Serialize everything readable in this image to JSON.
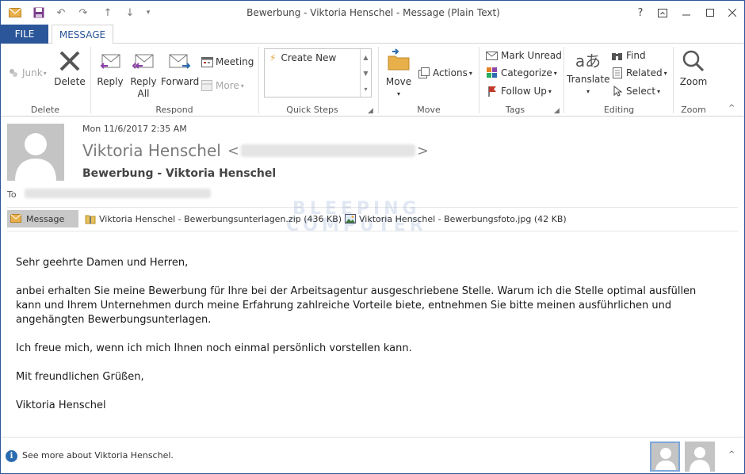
{
  "window": {
    "title": "Bewerbung - Viktoria Henschel - Message (Plain Text)",
    "help": "?",
    "controls": [
      "restore-ribbon",
      "minimize",
      "maximize",
      "close"
    ]
  },
  "tabs": {
    "file": "FILE",
    "message": "MESSAGE"
  },
  "ribbon": {
    "delete_group": {
      "junk": "Junk",
      "delete": "Delete",
      "label": "Delete"
    },
    "respond_group": {
      "reply": "Reply",
      "reply_all_1": "Reply",
      "reply_all_2": "All",
      "forward": "Forward",
      "meeting": "Meeting",
      "more": "More",
      "label": "Respond"
    },
    "quick_steps": {
      "create_new": "Create New",
      "label": "Quick Steps"
    },
    "move_group": {
      "move": "Move",
      "actions": "Actions",
      "label": "Move"
    },
    "tags_group": {
      "mark_unread": "Mark Unread",
      "categorize": "Categorize",
      "follow_up": "Follow Up",
      "label": "Tags"
    },
    "editing_group": {
      "translate": "Translate",
      "find": "Find",
      "related": "Related",
      "select": "Select",
      "label": "Editing"
    },
    "zoom_group": {
      "zoom": "Zoom",
      "label": "Zoom"
    }
  },
  "header": {
    "date": "Mon 11/6/2017 2:35 AM",
    "sender_name": "Viktoria Henschel",
    "subject": "Bewerbung - Viktoria Henschel",
    "to_label": "To"
  },
  "attachments": {
    "message_tab": "Message",
    "items": [
      {
        "name": "Viktoria Henschel - Bewerbungsunterlagen.zip (436 KB)",
        "icon": "zip-folder-icon"
      },
      {
        "name": "Viktoria Henschel - Bewerbungsfoto.jpg (42 KB)",
        "icon": "image-file-icon"
      }
    ]
  },
  "watermark": {
    "line1": "BLEEPING",
    "line2": "COMPUTER"
  },
  "body": {
    "paragraphs": [
      "Sehr geehrte Damen und Herren,",
      "anbei erhalten Sie meine Bewerbung für Ihre bei der Arbeitsagentur ausgeschriebene Stelle. Warum ich die Stelle optimal ausfüllen kann und Ihrem Unternehmen durch meine Erfahrung zahlreiche Vorteile biete, entnehmen Sie bitte meinen ausführlichen und angehängten Bewerbungsunterlagen.",
      "Ich freue mich, wenn ich mich Ihnen noch einmal persönlich vorstellen kann.",
      "Mit freundlichen Grüßen,",
      "Viktoria Henschel"
    ]
  },
  "footer": {
    "text": "See more about Viktoria Henschel."
  },
  "colors": {
    "accent": "#2b579a",
    "avatar_bg": "#c4c4c4"
  }
}
